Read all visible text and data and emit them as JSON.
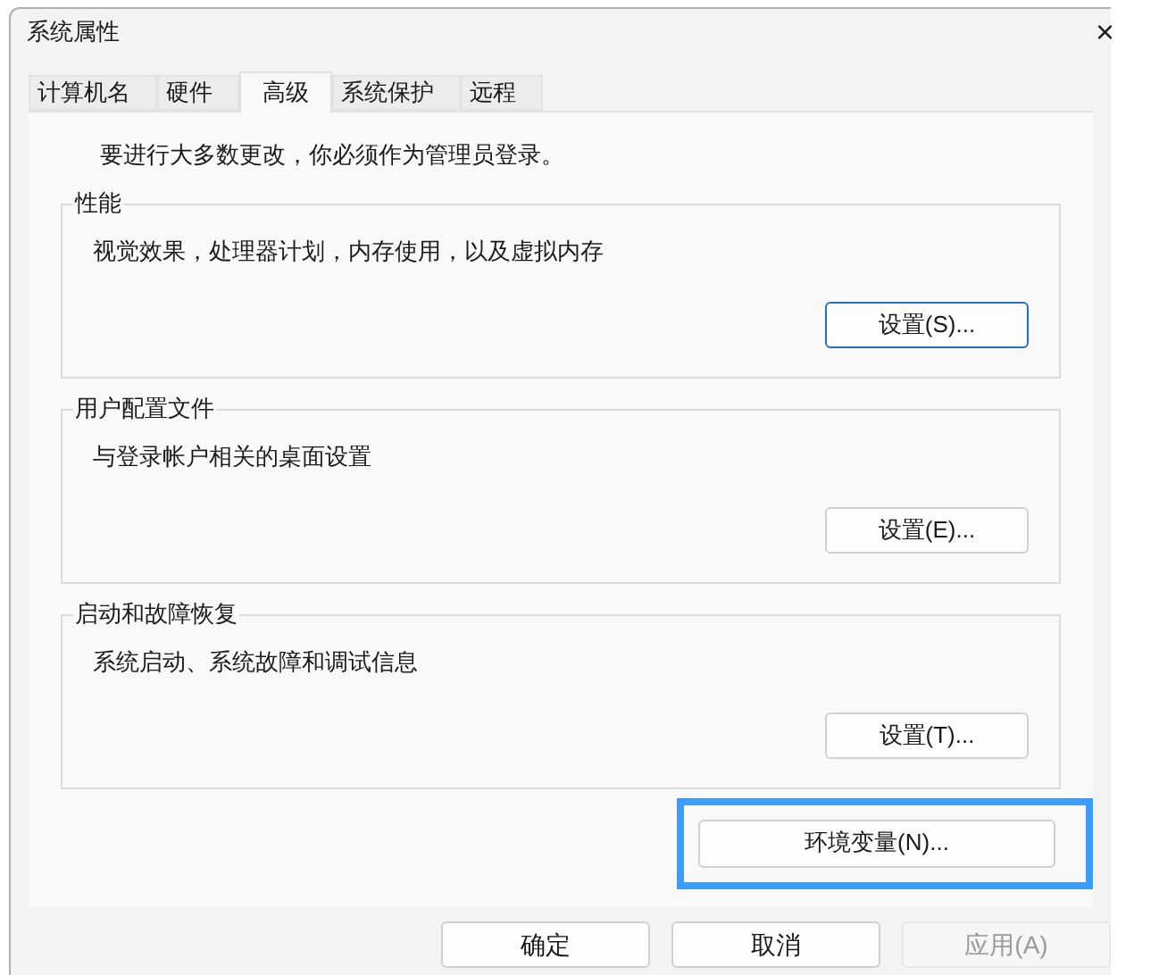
{
  "window": {
    "title": "系统属性",
    "close": "×"
  },
  "tabs": [
    {
      "label": "计算机名",
      "selected": false
    },
    {
      "label": "硬件",
      "selected": false
    },
    {
      "label": "高级",
      "selected": true
    },
    {
      "label": "系统保护",
      "selected": false
    },
    {
      "label": "远程",
      "selected": false
    }
  ],
  "notice": "要进行大多数更改，你必须作为管理员登录。",
  "groups": [
    {
      "title": "性能",
      "description": "视觉效果，处理器计划，内存使用，以及虚拟内存",
      "button": "设置(S)..."
    },
    {
      "title": "用户配置文件",
      "description": "与登录帐户相关的桌面设置",
      "button": "设置(E)..."
    },
    {
      "title": "启动和故障恢复",
      "description": "系统启动、系统故障和调试信息",
      "button": "设置(T)..."
    }
  ],
  "env_button": {
    "label": "环境变量(N)...",
    "highlighted": true
  },
  "footer_buttons": [
    {
      "label": "确定",
      "disabled": false
    },
    {
      "label": "取消",
      "disabled": false
    },
    {
      "label": "应用(A)",
      "disabled": true
    }
  ]
}
